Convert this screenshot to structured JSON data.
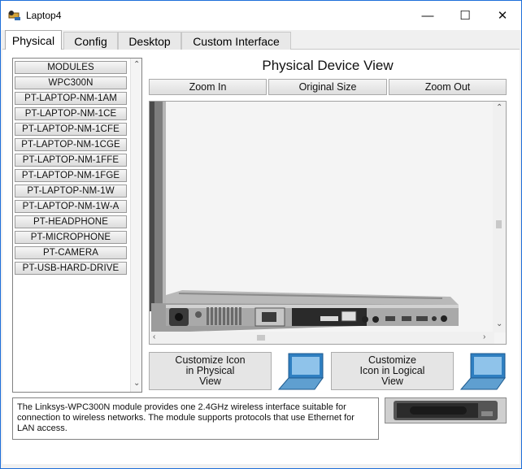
{
  "window": {
    "title": "Laptop4",
    "controls": {
      "minimize": "—",
      "maximize": "☐",
      "close": "✕"
    }
  },
  "tabs": [
    {
      "label": "Physical"
    },
    {
      "label": "Config"
    },
    {
      "label": "Desktop"
    },
    {
      "label": "Custom Interface"
    }
  ],
  "modules": {
    "items": [
      "MODULES",
      "WPC300N",
      "PT-LAPTOP-NM-1AM",
      "PT-LAPTOP-NM-1CE",
      "PT-LAPTOP-NM-1CFE",
      "PT-LAPTOP-NM-1CGE",
      "PT-LAPTOP-NM-1FFE",
      "PT-LAPTOP-NM-1FGE",
      "PT-LAPTOP-NM-1W",
      "PT-LAPTOP-NM-1W-A",
      "PT-HEADPHONE",
      "PT-MICROPHONE",
      "PT-CAMERA",
      "PT-USB-HARD-DRIVE"
    ]
  },
  "physical_view": {
    "title": "Physical Device View",
    "zoom_in": "Zoom In",
    "original_size": "Original Size",
    "zoom_out": "Zoom Out"
  },
  "custom": {
    "physical": "Customize Icon in Physical View",
    "logical": "Customize Icon in Logical View"
  },
  "info": {
    "text": "The Linksys-WPC300N module provides one 2.4GHz wireless interface suitable for connection to wireless networks. The module supports protocols that use Ethernet for LAN access."
  },
  "colors": {
    "window_border": "#1e6fd9",
    "laptop_icon": "#2f7fc1"
  }
}
